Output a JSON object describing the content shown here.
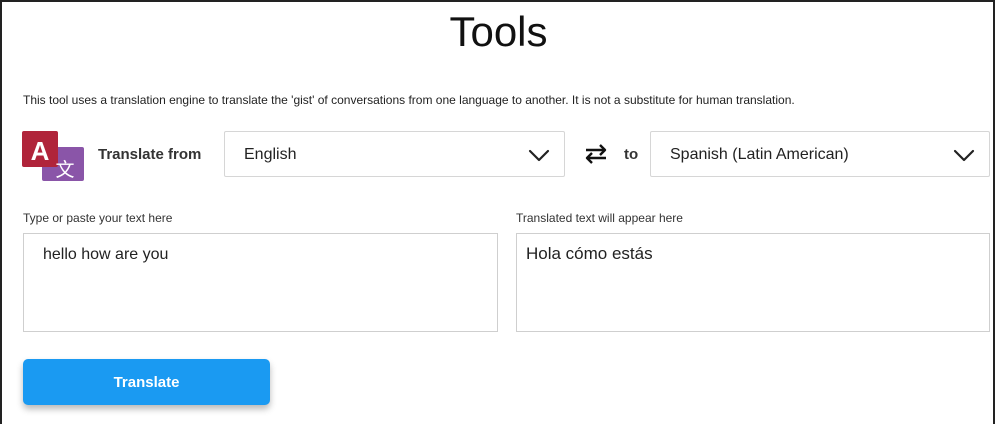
{
  "page": {
    "title": "Tools",
    "disclaimer": "This tool uses a translation engine to translate the 'gist' of conversations from one language to another. It is not a substitute for human translation."
  },
  "translator": {
    "from_label": "Translate from",
    "from_language": "English",
    "to_label": "to",
    "to_language": "Spanish (Latin American)",
    "input_label": "Type or paste your text here",
    "input_value": "hello how are you",
    "output_label": "Translated text will appear here",
    "output_value": "Hola cómo estás",
    "button_label": "Translate"
  },
  "icons": {
    "logo": "translate-logo-icon",
    "swap": "swap-arrows-icon",
    "dropdown": "chevron-down-icon"
  },
  "colors": {
    "button": "#1a9af2",
    "logo_red": "#b0243a",
    "logo_purple": "#8a55a8"
  }
}
